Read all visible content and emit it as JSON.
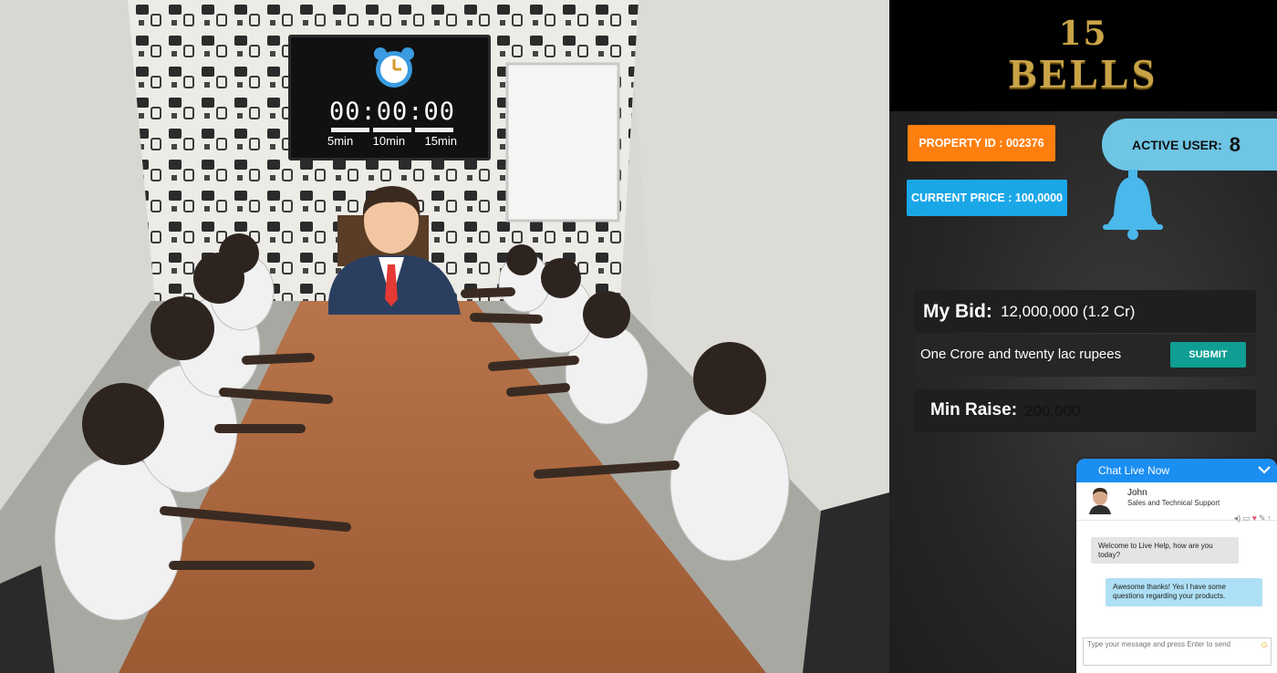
{
  "timer": {
    "display": "00:00:00",
    "presets": [
      "5min",
      "10min",
      "15min"
    ]
  },
  "brand": {
    "number": "15",
    "word": "BELLS"
  },
  "auction": {
    "property_id": "PROPERTY ID : 002376",
    "current_price": "CURRENT PRICE : 100,0000",
    "active_user_label": "ACTIVE USER:",
    "active_user_count": "8"
  },
  "bid": {
    "my_bid_label": "My Bid:",
    "my_bid_value": "12,000,000 (1.2 Cr)",
    "in_words": "One Crore and twenty lac rupees",
    "submit_label": "SUBMIT",
    "min_raise_label": "Min Raise:",
    "min_raise_value": "200,000"
  },
  "chat": {
    "header": "Chat Live Now",
    "agent_name": "John",
    "agent_role": "Sales and Technical Support",
    "messages": [
      {
        "from": "agent",
        "text": "Welcome to Live Help, how are you today?"
      },
      {
        "from": "user",
        "text": "Awesome thanks! Yes I have some questions regarding your products."
      }
    ],
    "input_placeholder": "Type your message and press Enter to send"
  },
  "colors": {
    "property_tag": "#ff7f0e",
    "price_tag": "#1aa7e8",
    "active_user": "#6ec5e4",
    "submit": "#0f9e94",
    "chat_header": "#1b8ef2",
    "logo_gold": "#c9a447"
  },
  "icons": [
    "alarm-clock-icon",
    "bell-icon",
    "chevron-down-icon",
    "emoji-icon"
  ]
}
